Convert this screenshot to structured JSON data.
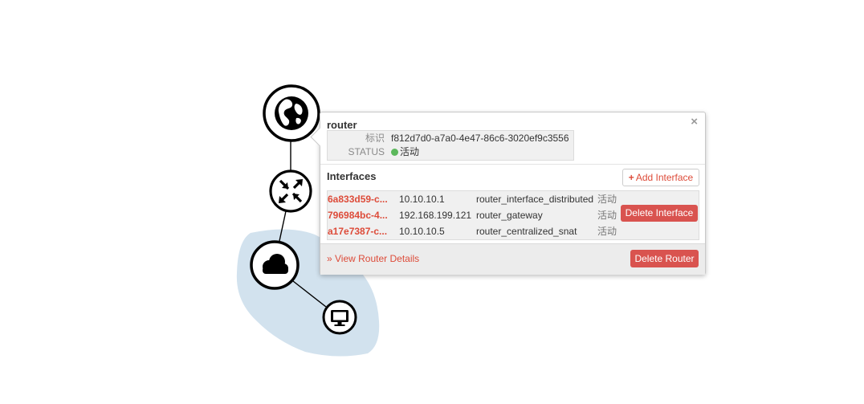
{
  "topology": {
    "nodes": [
      {
        "type": "external-network",
        "icon": "globe-icon"
      },
      {
        "type": "router",
        "icon": "router-arrows-icon"
      },
      {
        "type": "network",
        "icon": "cloud-icon"
      },
      {
        "type": "instance",
        "icon": "monitor-icon"
      }
    ]
  },
  "popup": {
    "title": "router",
    "close_label": "×",
    "info": {
      "id_label": "标识",
      "id_value": "f812d7d0-a7a0-4e47-86c6-3020ef9c3556",
      "status_label": "STATUS",
      "status_value": "活动",
      "status_color": "#5cb85c"
    },
    "interfaces_title": "Interfaces",
    "add_interface_label": "Add Interface",
    "add_icon": "+",
    "interfaces": [
      {
        "id": "6a833d59-c...",
        "ip": "10.10.10.1",
        "name": "router_interface_distributed",
        "status": "活动"
      },
      {
        "id": "796984bc-4...",
        "ip": "192.168.199.121",
        "name": "router_gateway",
        "status": "活动"
      },
      {
        "id": "a17e7387-c...",
        "ip": "10.10.10.5",
        "name": "router_centralized_snat",
        "status": "活动"
      }
    ],
    "delete_interface_label": "Delete Interface",
    "view_details_label": "» View Router Details",
    "delete_router_label": "Delete Router"
  },
  "colors": {
    "accent": "#dd4b39",
    "danger": "#d9534f",
    "network_area": "#d2e2ee"
  }
}
